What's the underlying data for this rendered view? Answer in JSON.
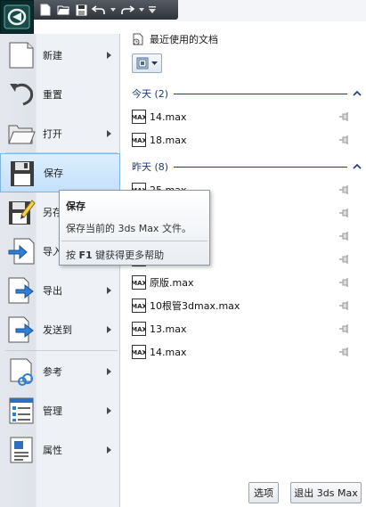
{
  "quick_access": {
    "icons": [
      "new-icon",
      "open-icon",
      "save-icon",
      "undo-icon",
      "redo-icon",
      "customize-icon"
    ]
  },
  "menu": {
    "items": [
      {
        "label": "新建",
        "icon": "new-document-icon",
        "has_submenu": true
      },
      {
        "label": "重置",
        "icon": "reset-icon",
        "has_submenu": false
      },
      {
        "label": "打开",
        "icon": "open-folder-icon",
        "has_submenu": true
      },
      {
        "label": "保存",
        "icon": "save-icon",
        "has_submenu": false,
        "active": true
      },
      {
        "label": "另存为",
        "icon": "save-as-icon",
        "has_submenu": true
      },
      {
        "label": "导入",
        "icon": "import-icon",
        "has_submenu": true
      },
      {
        "label": "导出",
        "icon": "export-icon",
        "has_submenu": true
      },
      {
        "label": "发送到",
        "icon": "send-to-icon",
        "has_submenu": true
      },
      {
        "label": "参考",
        "icon": "reference-icon",
        "has_submenu": true
      },
      {
        "label": "管理",
        "icon": "manage-icon",
        "has_submenu": true
      },
      {
        "label": "属性",
        "icon": "properties-icon",
        "has_submenu": true
      }
    ]
  },
  "recent": {
    "title": "最近使用的文档",
    "groups": [
      {
        "label": "今天 (2)",
        "files": [
          "14.max",
          "18.max"
        ]
      },
      {
        "label": "昨天 (8)",
        "files": [
          "25.max",
          "",
          "",
          "x - 副本.max",
          "原版.max",
          "10根管3dmax.max",
          "13.max",
          "14.max"
        ]
      }
    ]
  },
  "tooltip": {
    "title": "保存",
    "description": "保存当前的 3ds Max 文件。",
    "help_prefix": "按 ",
    "help_key": "F1",
    "help_suffix": " 键获得更多帮助"
  },
  "buttons": {
    "options": "选项",
    "exit": "退出 3ds Max"
  },
  "colors": {
    "group_header": "#1e3a7b",
    "active_item": "#c3e0fb",
    "app_button": "#0b2c2c"
  }
}
